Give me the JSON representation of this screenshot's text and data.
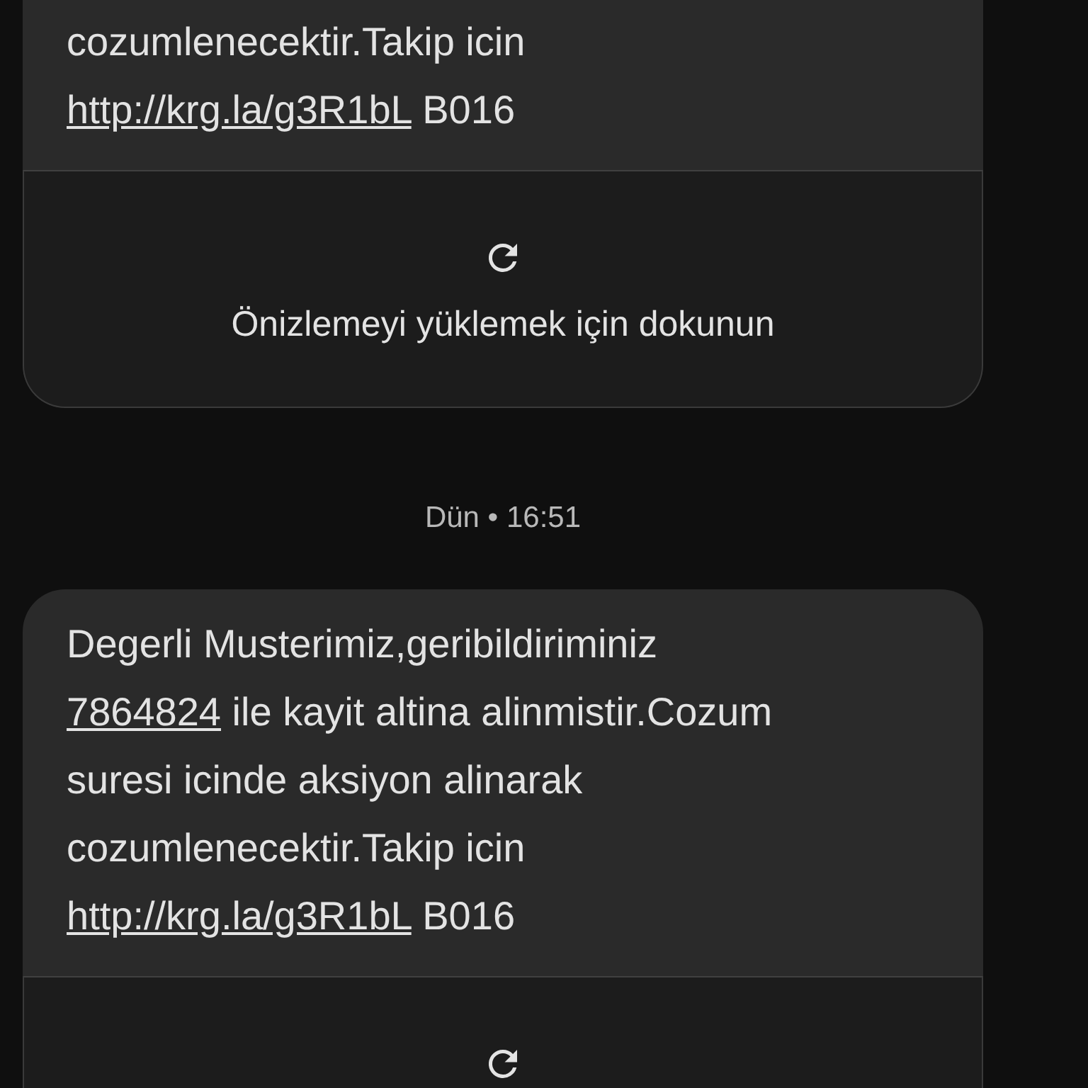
{
  "conversation": [
    {
      "kind": "message",
      "lines": [
        [
          {
            "text": "cozumlenecektir.Takip icin",
            "link": false
          }
        ],
        [
          {
            "text": "http://krg.la/g3R1bL",
            "link": true
          },
          {
            "text": " B016",
            "link": false
          }
        ]
      ],
      "preview": true,
      "preview_label": "Önizlemeyi yüklemek için dokunun"
    },
    {
      "kind": "timestamp",
      "text": "Dün • 16:51"
    },
    {
      "kind": "message",
      "lines": [
        [
          {
            "text": "Degerli Musterimiz,geribildiriminiz",
            "link": false
          }
        ],
        [
          {
            "text": "7864824",
            "link": true
          },
          {
            "text": " ile kayit altina alinmistir.Cozum",
            "link": false
          }
        ],
        [
          {
            "text": "suresi icinde aksiyon alinarak",
            "link": false
          }
        ],
        [
          {
            "text": "cozumlenecektir.Takip icin",
            "link": false
          }
        ],
        [
          {
            "text": "http://krg.la/g3R1bL",
            "link": true
          },
          {
            "text": " B016",
            "link": false
          }
        ]
      ],
      "preview": true
    }
  ]
}
